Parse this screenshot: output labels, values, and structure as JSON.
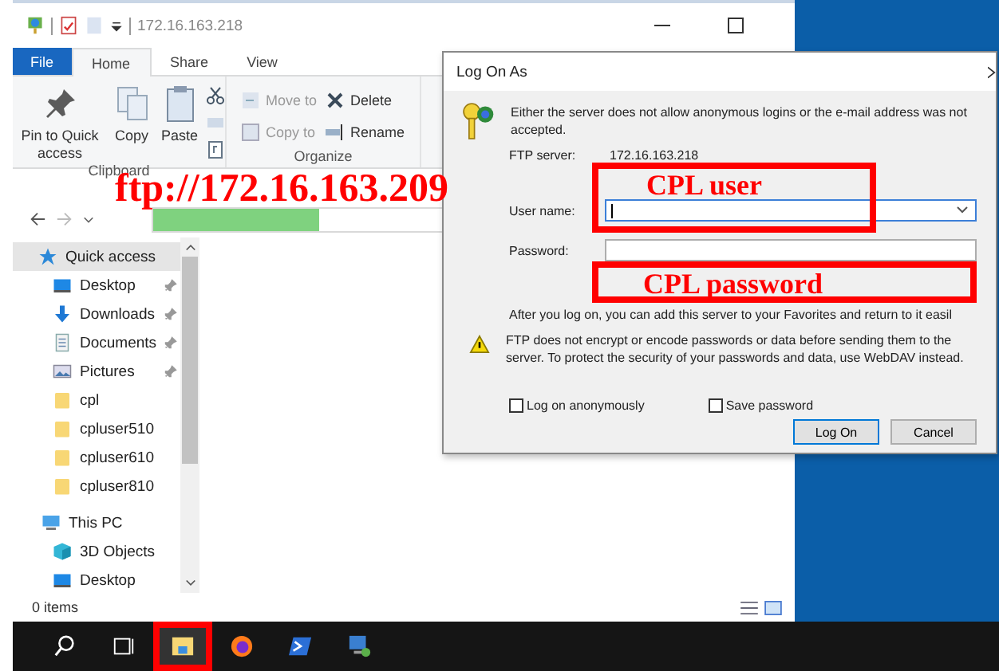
{
  "explorer": {
    "title": "172.16.163.218",
    "tabs": [
      {
        "label": "File",
        "kind": "file",
        "selected": false
      },
      {
        "label": "Home",
        "kind": "tab",
        "selected": true
      },
      {
        "label": "Share",
        "kind": "tab",
        "selected": false
      },
      {
        "label": "View",
        "kind": "tab",
        "selected": false
      }
    ],
    "clipboard": {
      "label": "Clipboard",
      "buttons": [
        {
          "label": "Pin to Quick access"
        },
        {
          "label": "Copy"
        },
        {
          "label": "Paste"
        }
      ]
    },
    "organize": {
      "label": "Organize",
      "buttons": [
        {
          "label": "Move to",
          "disabled": true
        },
        {
          "label": "Delete",
          "disabled": false
        },
        {
          "label": "Copy to",
          "disabled": true
        },
        {
          "label": "Rename",
          "disabled": false
        }
      ]
    },
    "address_bar": {
      "level": 0.35
    },
    "nav": [
      {
        "label": "Quick access",
        "kind": "quick",
        "selected": true,
        "children": [
          {
            "label": "Desktop",
            "kind": "desktop",
            "pinned": true
          },
          {
            "label": "Downloads",
            "kind": "downloads",
            "pinned": true
          },
          {
            "label": "Documents",
            "kind": "documents",
            "pinned": true
          },
          {
            "label": "Pictures",
            "kind": "pictures",
            "pinned": true
          },
          {
            "label": "cpl",
            "kind": "folder",
            "pinned": false
          },
          {
            "label": "cpluser510",
            "kind": "folder",
            "pinned": false
          },
          {
            "label": "cpluser610",
            "kind": "folder",
            "pinned": false
          },
          {
            "label": "cpluser810",
            "kind": "folder",
            "pinned": false
          }
        ]
      },
      {
        "label": "This PC",
        "kind": "pc",
        "selected": false,
        "children": [
          {
            "label": "3D Objects",
            "kind": "objects",
            "pinned": false
          },
          {
            "label": "Desktop",
            "kind": "desktop",
            "pinned": false
          }
        ]
      }
    ],
    "status": "0 items"
  },
  "dialog": {
    "title": "Log On As",
    "message": "Either the server does not allow anonymous logins or the e-mail address was not accepted.",
    "fields": [
      {
        "label": "FTP server:",
        "kind": "text",
        "value": "172.16.163.218"
      },
      {
        "label": "User name:",
        "kind": "combo",
        "focused": true
      },
      {
        "label": "Password:",
        "kind": "password",
        "focused": false
      }
    ],
    "note": "After you log on, you can add this server to your Favorites and return to it easil",
    "warning": "FTP does not encrypt or encode passwords or data before sending them to the server.  To protect the security of your passwords and data, use WebDAV instead.",
    "checkboxes": [
      {
        "label": "Log on anonymously",
        "checked": false
      },
      {
        "label": "Save password",
        "checked": false
      }
    ],
    "buttons": [
      {
        "label": "Log On",
        "default": true
      },
      {
        "label": "Cancel",
        "default": false
      }
    ]
  },
  "annotations": [
    {
      "kind": "url",
      "text": "ftp://172.16.163.209"
    },
    {
      "kind": "box",
      "text": "CPL user"
    },
    {
      "kind": "box",
      "text": "CPL password"
    }
  ],
  "taskbar": [
    {
      "marked": false
    },
    {
      "marked": false
    },
    {
      "marked": true
    },
    {
      "marked": false
    },
    {
      "marked": false
    },
    {
      "marked": false
    }
  ]
}
